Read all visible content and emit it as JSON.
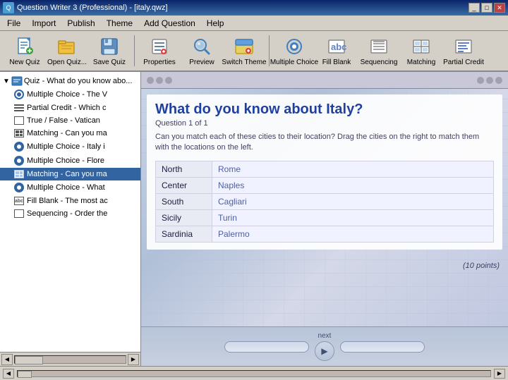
{
  "titleBar": {
    "title": "Question Writer 3 (Professional) - [italy.qwz]",
    "controls": [
      "_",
      "□",
      "✕"
    ]
  },
  "menuBar": {
    "items": [
      "File",
      "Import",
      "Publish",
      "Theme",
      "Add Question",
      "Help"
    ]
  },
  "toolbar": {
    "buttons": [
      {
        "id": "new-quiz",
        "label": "New Quiz",
        "icon": "new-doc"
      },
      {
        "id": "open-quiz",
        "label": "Open Quiz...",
        "icon": "folder-open"
      },
      {
        "id": "save-quiz",
        "label": "Save Quiz",
        "icon": "save-floppy"
      },
      {
        "id": "properties",
        "label": "Properties",
        "icon": "properties"
      },
      {
        "id": "preview",
        "label": "Preview",
        "icon": "preview-magnify"
      },
      {
        "id": "switch-theme",
        "label": "Switch Theme",
        "icon": "theme-switch"
      },
      {
        "id": "multiple-choice",
        "label": "Multiple Choice",
        "icon": "mc-circle"
      },
      {
        "id": "fill-blank",
        "label": "Fill Blank",
        "icon": "fill-blank-abc"
      },
      {
        "id": "sequencing",
        "label": "Sequencing",
        "icon": "seq-lines"
      },
      {
        "id": "matching",
        "label": "Matching",
        "icon": "match-grid"
      },
      {
        "id": "partial-credit",
        "label": "Partial Credit",
        "icon": "partial-credit"
      }
    ]
  },
  "treePanel": {
    "root": "Quiz - What do you know abo...",
    "items": [
      {
        "id": "mc1",
        "type": "mc",
        "label": "Multiple Choice - The V",
        "selected": false
      },
      {
        "id": "pc1",
        "type": "lines",
        "label": "Partial Credit - Which c",
        "selected": false
      },
      {
        "id": "tf1",
        "type": "doc",
        "label": "True / False - Vatican",
        "selected": false
      },
      {
        "id": "mat1",
        "type": "grid",
        "label": "Matching - Can you ma",
        "selected": false
      },
      {
        "id": "mc2",
        "type": "mc",
        "label": "Multiple Choice - Italy i",
        "selected": false
      },
      {
        "id": "mc3",
        "type": "mc",
        "label": "Multiple Choice - Flore",
        "selected": false
      },
      {
        "id": "mat2",
        "type": "grid",
        "label": "Matching - Can you ma",
        "selected": true
      },
      {
        "id": "mc4",
        "type": "mc",
        "label": "Multiple Choice - What",
        "selected": false
      },
      {
        "id": "fb1",
        "type": "abc",
        "label": "Fill Blank - The most ac",
        "selected": false
      },
      {
        "id": "seq1",
        "type": "seq",
        "label": "Sequencing - Order the",
        "selected": false
      }
    ]
  },
  "preview": {
    "navDotsLeft": [
      "●",
      "●",
      "●"
    ],
    "navDotsRight": [
      "●",
      "●",
      "●"
    ],
    "questionTitle": "What do you know about Italy?",
    "questionNumber": "Question 1 of 1",
    "questionDesc": "Can you match each of these cities to their location? Drag the cities on the right to match them with the locations on the left.",
    "matchingRows": [
      {
        "location": "North",
        "city": "Rome"
      },
      {
        "location": "Center",
        "city": "Naples"
      },
      {
        "location": "South",
        "city": "Cagliari"
      },
      {
        "location": "Sicily",
        "city": "Turin"
      },
      {
        "location": "Sardinia",
        "city": "Palermo"
      }
    ],
    "points": "(10 points)",
    "nextLabel": "next"
  }
}
